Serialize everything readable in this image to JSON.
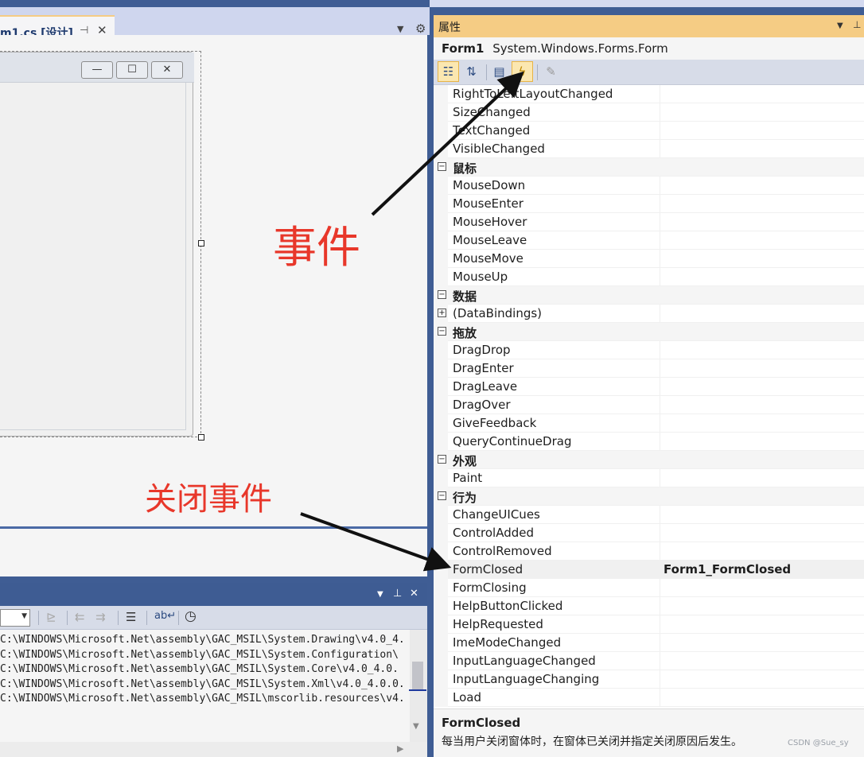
{
  "document_tab": {
    "title": "m1.cs [设计]",
    "pin_icon": "pin-icon",
    "close_glyph": "✕"
  },
  "form_window": {
    "minimize_glyph": "—",
    "maximize_glyph": "☐",
    "close_glyph": "✕"
  },
  "output": {
    "lines": [
      "C:\\WINDOWS\\Microsoft.Net\\assembly\\GAC_MSIL\\System.Drawing\\v4.0_4.",
      "C:\\WINDOWS\\Microsoft.Net\\assembly\\GAC_MSIL\\System.Configuration\\",
      "C:\\WINDOWS\\Microsoft.Net\\assembly\\GAC_MSIL\\System.Core\\v4.0_4.0.",
      "C:\\WINDOWS\\Microsoft.Net\\assembly\\GAC_MSIL\\System.Xml\\v4.0_4.0.0.",
      "C:\\WINDOWS\\Microsoft.Net\\assembly\\GAC_MSIL\\mscorlib.resources\\v4."
    ]
  },
  "properties": {
    "panel_title": "属性",
    "object_name": "Form1",
    "object_type": "System.Windows.Forms.Form",
    "rows": [
      {
        "kind": "prop",
        "name": "RightToLeftLayoutChanged",
        "value": ""
      },
      {
        "kind": "prop",
        "name": "SizeChanged",
        "value": ""
      },
      {
        "kind": "prop",
        "name": "TextChanged",
        "value": ""
      },
      {
        "kind": "prop",
        "name": "VisibleChanged",
        "value": ""
      },
      {
        "kind": "cat",
        "name": "鼠标",
        "expander": "⊟"
      },
      {
        "kind": "prop",
        "name": "MouseDown",
        "value": ""
      },
      {
        "kind": "prop",
        "name": "MouseEnter",
        "value": ""
      },
      {
        "kind": "prop",
        "name": "MouseHover",
        "value": ""
      },
      {
        "kind": "prop",
        "name": "MouseLeave",
        "value": ""
      },
      {
        "kind": "prop",
        "name": "MouseMove",
        "value": ""
      },
      {
        "kind": "prop",
        "name": "MouseUp",
        "value": ""
      },
      {
        "kind": "cat",
        "name": "数据",
        "expander": "⊟"
      },
      {
        "kind": "prop",
        "name": "(DataBindings)",
        "value": "",
        "expander": "⊞"
      },
      {
        "kind": "cat",
        "name": "拖放",
        "expander": "⊟"
      },
      {
        "kind": "prop",
        "name": "DragDrop",
        "value": ""
      },
      {
        "kind": "prop",
        "name": "DragEnter",
        "value": ""
      },
      {
        "kind": "prop",
        "name": "DragLeave",
        "value": ""
      },
      {
        "kind": "prop",
        "name": "DragOver",
        "value": ""
      },
      {
        "kind": "prop",
        "name": "GiveFeedback",
        "value": ""
      },
      {
        "kind": "prop",
        "name": "QueryContinueDrag",
        "value": ""
      },
      {
        "kind": "cat",
        "name": "外观",
        "expander": "⊟"
      },
      {
        "kind": "prop",
        "name": "Paint",
        "value": ""
      },
      {
        "kind": "cat",
        "name": "行为",
        "expander": "⊟"
      },
      {
        "kind": "prop",
        "name": "ChangeUICues",
        "value": ""
      },
      {
        "kind": "prop",
        "name": "ControlAdded",
        "value": ""
      },
      {
        "kind": "prop",
        "name": "ControlRemoved",
        "value": ""
      },
      {
        "kind": "prop",
        "name": "FormClosed",
        "value": "Form1_FormClosed",
        "selected": true
      },
      {
        "kind": "prop",
        "name": "FormClosing",
        "value": ""
      },
      {
        "kind": "prop",
        "name": "HelpButtonClicked",
        "value": ""
      },
      {
        "kind": "prop",
        "name": "HelpRequested",
        "value": ""
      },
      {
        "kind": "prop",
        "name": "ImeModeChanged",
        "value": ""
      },
      {
        "kind": "prop",
        "name": "InputLanguageChanged",
        "value": ""
      },
      {
        "kind": "prop",
        "name": "InputLanguageChanging",
        "value": ""
      },
      {
        "kind": "prop",
        "name": "Load",
        "value": ""
      }
    ],
    "description_name": "FormClosed",
    "description_text": "每当用户关闭窗体时，在窗体已关闭并指定关闭原因后发生。",
    "watermark": "CSDN @Sue_sy"
  },
  "annotations": {
    "events_label": "事件",
    "close_event_label": "关闭事件"
  },
  "colors": {
    "annotation_red": "#e8372a",
    "panel_title_bg": "#f5cc84",
    "chrome_blue": "#3f5d94"
  }
}
